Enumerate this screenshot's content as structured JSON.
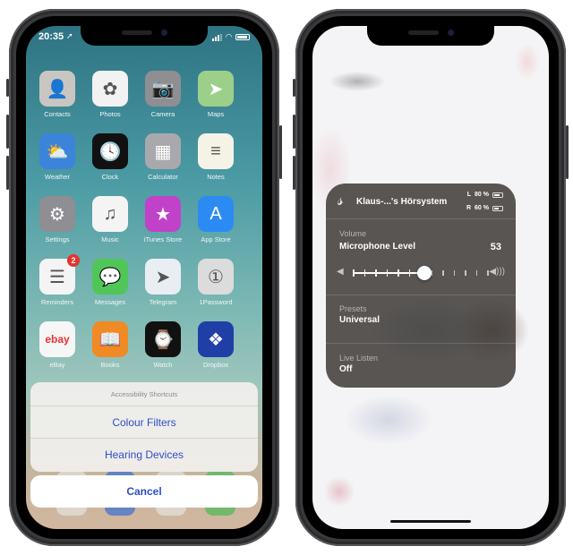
{
  "left_phone": {
    "status_bar": {
      "time": "20:35",
      "location_icon": "location-arrow-icon",
      "signal_icon": "cellular-signal-icon",
      "wifi_icon": "wifi-icon",
      "battery_icon": "battery-icon"
    },
    "apps": [
      {
        "label": "Contacts",
        "icon": "contacts-icon",
        "color": "#c9c6c2",
        "glyph": "👤"
      },
      {
        "label": "Photos",
        "icon": "photos-icon",
        "color": "#f2f2f2",
        "glyph": "✿"
      },
      {
        "label": "Camera",
        "icon": "camera-icon",
        "color": "#8e8e93",
        "glyph": "📷"
      },
      {
        "label": "Maps",
        "icon": "maps-icon",
        "color": "#9ccf8a",
        "glyph": "➤"
      },
      {
        "label": "Weather",
        "icon": "weather-icon",
        "color": "#3b84d9",
        "glyph": "⛅"
      },
      {
        "label": "Clock",
        "icon": "clock-icon",
        "color": "#111111",
        "glyph": "🕓"
      },
      {
        "label": "Calculator",
        "icon": "calculator-icon",
        "color": "#a9a9ad",
        "glyph": "▦"
      },
      {
        "label": "Notes",
        "icon": "notes-icon",
        "color": "#f5f2e6",
        "glyph": "≡"
      },
      {
        "label": "Settings",
        "icon": "settings-icon",
        "color": "#8e8e93",
        "glyph": "⚙"
      },
      {
        "label": "Music",
        "icon": "music-icon",
        "color": "#f4f4f4",
        "glyph": "♫"
      },
      {
        "label": "iTunes Store",
        "icon": "itunes-store-icon",
        "color": "#c142c8",
        "glyph": "★"
      },
      {
        "label": "App Store",
        "icon": "app-store-icon",
        "color": "#2c8bf2",
        "glyph": "A"
      },
      {
        "label": "Reminders",
        "icon": "reminders-icon",
        "color": "#f4f4f4",
        "glyph": "☰",
        "badge": "2"
      },
      {
        "label": "Messages",
        "icon": "messages-icon",
        "color": "#52c559",
        "glyph": "💬"
      },
      {
        "label": "Telegram",
        "icon": "telegram-icon",
        "color": "#e8eef2",
        "glyph": "➤"
      },
      {
        "label": "1Password",
        "icon": "1password-icon",
        "color": "#dcdcdc",
        "glyph": "①"
      },
      {
        "label": "eBay",
        "icon": "ebay-icon",
        "color": "#f6f6f6",
        "glyph": "ebay"
      },
      {
        "label": "Books",
        "icon": "books-icon",
        "color": "#f08a24",
        "glyph": "📖"
      },
      {
        "label": "Watch",
        "icon": "watch-icon",
        "color": "#111111",
        "glyph": "⌚"
      },
      {
        "label": "Dropbox",
        "icon": "dropbox-icon",
        "color": "#1f3fa6",
        "glyph": "❖"
      }
    ],
    "action_sheet": {
      "title": "Accessibility Shortcuts",
      "options": [
        "Colour Filters",
        "Hearing Devices"
      ],
      "cancel_label": "Cancel",
      "accent_color": "#2e4ec6"
    }
  },
  "right_phone": {
    "hearing_panel": {
      "icon": "ear-icon",
      "device_name": "Klaus-...'s Hörsystem",
      "left_battery": {
        "side": "L",
        "label": "80 %",
        "level": 0.8
      },
      "right_battery": {
        "side": "R",
        "label": "60 %",
        "level": 0.6
      },
      "volume_section_label": "Volume",
      "volume_title": "Microphone Level",
      "volume_value": "53",
      "slider_fraction": 0.53,
      "slider_steps": 13,
      "presets_label": "Presets",
      "presets_value": "Universal",
      "live_listen_label": "Live Listen",
      "live_listen_value": "Off"
    }
  }
}
